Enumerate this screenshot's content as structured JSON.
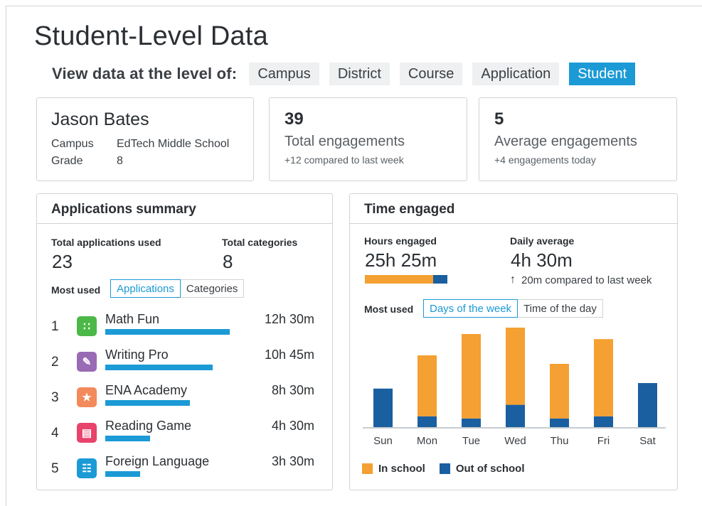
{
  "page": {
    "title": "Student-Level Data"
  },
  "level_selector": {
    "label": "View data at the level of:",
    "options": [
      "Campus",
      "District",
      "Course",
      "Application",
      "Student"
    ],
    "selected": "Student"
  },
  "student": {
    "name": "Jason Bates",
    "campus_label": "Campus",
    "campus_value": "EdTech Middle School",
    "grade_label": "Grade",
    "grade_value": "8"
  },
  "total_engagements": {
    "value": "39",
    "label": "Total engagements",
    "sub": "+12 compared to last week"
  },
  "average_engagements": {
    "value": "5",
    "label": "Average engagements",
    "sub": "+4 engagements today"
  },
  "applications_summary": {
    "title": "Applications summary",
    "total_apps_label": "Total applications used",
    "total_apps_value": "23",
    "total_categories_label": "Total categories",
    "total_categories_value": "8",
    "most_used_label": "Most used",
    "tabs": [
      "Applications",
      "Categories"
    ],
    "active_tab": "Applications",
    "apps": [
      {
        "rank": "1",
        "name": "Math Fun",
        "time": "12h 30m",
        "hours": 12.5,
        "icon": "math-icon",
        "color": "#4cb848",
        "glyph": "∷"
      },
      {
        "rank": "2",
        "name": "Writing Pro",
        "time": "10h 45m",
        "hours": 10.75,
        "icon": "writing-icon",
        "color": "#9a6bb5",
        "glyph": "✎"
      },
      {
        "rank": "3",
        "name": "ENA Academy",
        "time": "8h 30m",
        "hours": 8.5,
        "icon": "academy-icon",
        "color": "#f28a5b",
        "glyph": "★"
      },
      {
        "rank": "4",
        "name": "Reading Game",
        "time": "4h 30m",
        "hours": 4.5,
        "icon": "book-icon",
        "color": "#e8436b",
        "glyph": "▤"
      },
      {
        "rank": "5",
        "name": "Foreign Language",
        "time": "3h 30m",
        "hours": 3.5,
        "icon": "language-icon",
        "color": "#1b9ad6",
        "glyph": "☷"
      }
    ]
  },
  "time_engaged": {
    "title": "Time engaged",
    "hours_label": "Hours engaged",
    "hours_value": "25h 25m",
    "hours_in_school_fraction": 0.83,
    "daily_avg_label": "Daily average",
    "daily_avg_value": "4h 30m",
    "daily_delta": "20m compared to last week",
    "most_used_label": "Most used",
    "tabs": [
      "Days of the week",
      "Time of the day"
    ],
    "active_tab": "Days of the week"
  },
  "colors": {
    "accent": "#1b9ad6",
    "in_school": "#f5a032",
    "out_of_school": "#1a5fa0"
  },
  "chart_data": {
    "type": "bar",
    "stacked": true,
    "categories": [
      "Sun",
      "Mon",
      "Tue",
      "Wed",
      "Thu",
      "Fri",
      "Sat"
    ],
    "series": [
      {
        "name": "Out of school",
        "values": [
          0.92,
          0.27,
          0.22,
          0.54,
          0.22,
          0.27,
          1.05
        ]
      },
      {
        "name": "In school",
        "values": [
          0,
          1.43,
          1.98,
          1.81,
          1.28,
          1.81,
          0
        ]
      }
    ],
    "legend": [
      "In school",
      "Out of school"
    ],
    "legend_position": "bottom-left",
    "grid": false
  }
}
